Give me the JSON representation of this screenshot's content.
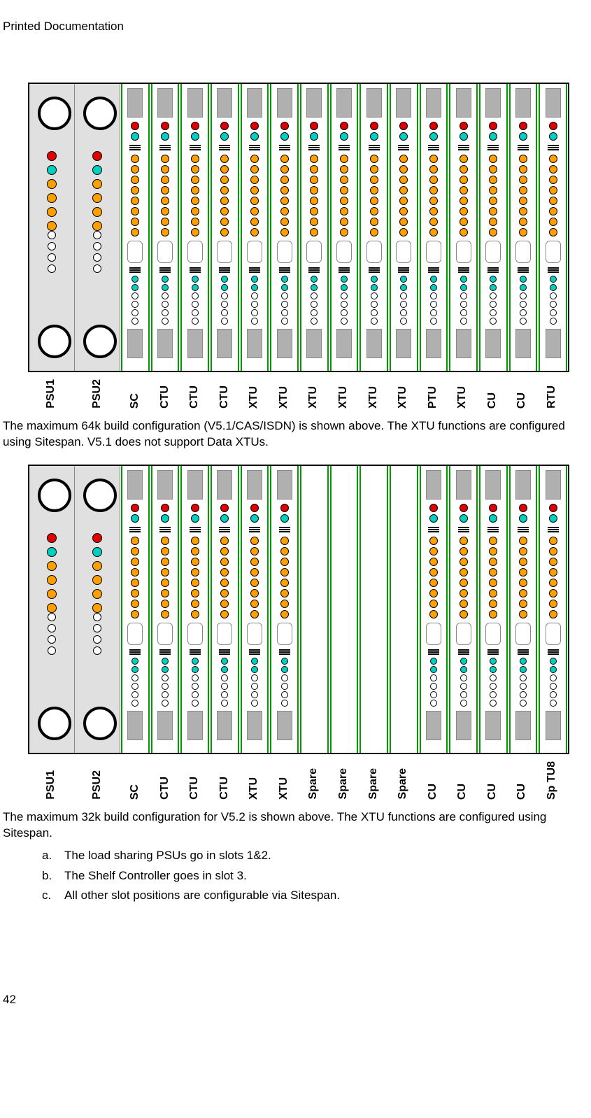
{
  "header": "Printed Documentation",
  "page_number": "42",
  "shelf1": {
    "psu_labels": [
      "PSU1",
      "PSU2"
    ],
    "slot_labels": [
      "SC",
      "CTU",
      "CTU",
      "CTU",
      "XTU",
      "XTU",
      "XTU",
      "XTU",
      "XTU",
      "XTU",
      "PTU",
      "XTU",
      "CU",
      "CU",
      "RTU"
    ],
    "empty": []
  },
  "para1": "The maximum 64k build configuration (V5.1/CAS/ISDN) is shown above. The XTU functions are configured using Sitespan. V5.1 does not support Data XTUs.",
  "shelf2": {
    "psu_labels": [
      "PSU1",
      "PSU2"
    ],
    "slot_labels": [
      "SC",
      "CTU",
      "CTU",
      "CTU",
      "XTU",
      "XTU",
      "Spare",
      "Spare",
      "Spare",
      "Spare",
      "CU",
      "CU",
      "CU",
      "CU",
      "Sp TU8"
    ],
    "empty": [
      6,
      7,
      8,
      9
    ]
  },
  "para2": "The maximum 32k build configuration for V5.2 is shown above. The XTU functions are configured using Sitespan.",
  "list": [
    {
      "l": "a.",
      "t": "The load sharing PSUs go in slots 1&2."
    },
    {
      "l": "b.",
      "t": "The Shelf Controller goes in slot 3."
    },
    {
      "l": "c.",
      "t": "All other slot positions are configurable via Sitespan."
    }
  ]
}
